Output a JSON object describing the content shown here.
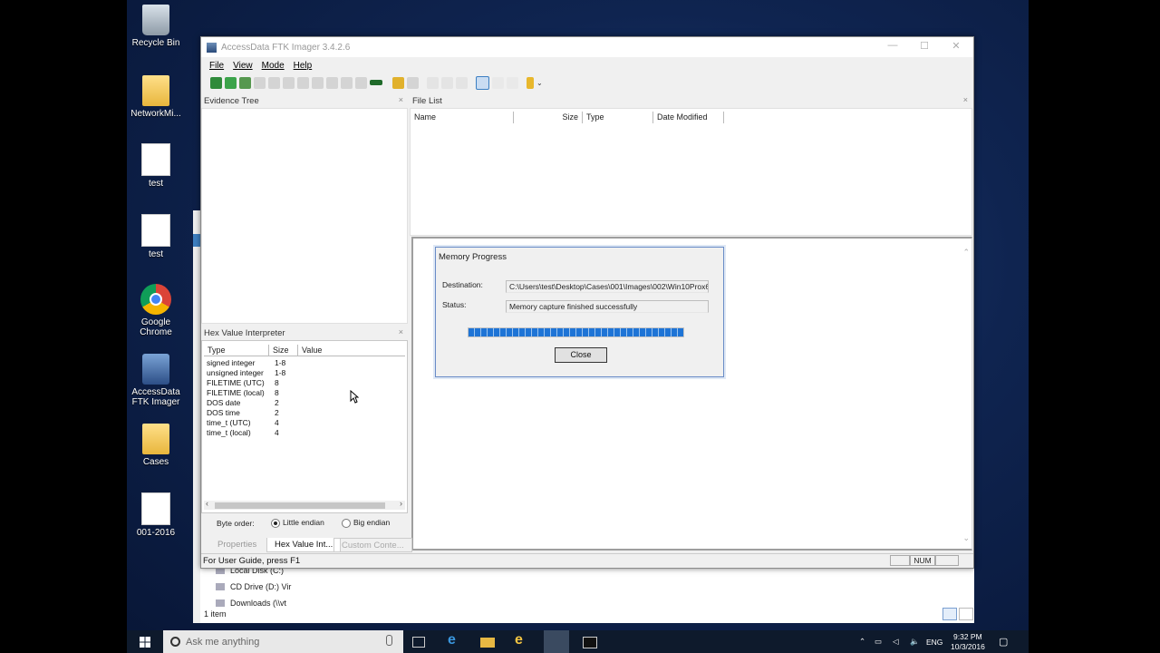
{
  "desktop": {
    "icons": [
      {
        "label": "Recycle Bin",
        "icon": "recycle-bin-icon"
      },
      {
        "label": "NetworkMi...",
        "icon": "folder-icon"
      },
      {
        "label": "test",
        "icon": "text-file-icon"
      },
      {
        "label": "test",
        "icon": "document-icon"
      },
      {
        "label": "Google Chrome",
        "icon": "chrome-icon"
      },
      {
        "label": "AccessData FTK Imager",
        "icon": "ftk-imager-icon"
      },
      {
        "label": "Cases",
        "icon": "folder-icon"
      },
      {
        "label": "001-2016",
        "icon": "document-icon"
      }
    ]
  },
  "explorer": {
    "items": [
      "Local Disk (C:)",
      "CD Drive (D:) Vir",
      "Downloads (\\\\vt"
    ],
    "status": "1 item"
  },
  "window": {
    "title": "AccessData FTK Imager 3.4.2.6",
    "controls": {
      "minimize": "—",
      "maximize": "☐",
      "close": "✕"
    },
    "menu": {
      "file": "File",
      "view": "View",
      "mode": "Mode",
      "help": "Help"
    },
    "evidence_tree": {
      "title": "Evidence Tree",
      "close": "×"
    },
    "file_list": {
      "title": "File List",
      "close": "×",
      "columns": [
        "Name",
        "Size",
        "Type",
        "Date Modified"
      ]
    },
    "hex_interpreter": {
      "title": "Hex Value Interpreter",
      "close": "×",
      "columns": [
        "Type",
        "Size",
        "Value"
      ],
      "rows": [
        {
          "type": "signed integer",
          "size": "1-8"
        },
        {
          "type": "unsigned integer",
          "size": "1-8"
        },
        {
          "type": "FILETIME (UTC)",
          "size": "8"
        },
        {
          "type": "FILETIME (local)",
          "size": "8"
        },
        {
          "type": "DOS date",
          "size": "2"
        },
        {
          "type": "DOS time",
          "size": "2"
        },
        {
          "type": "time_t (UTC)",
          "size": "4"
        },
        {
          "type": "time_t (local)",
          "size": "4"
        }
      ],
      "byte_order_label": "Byte order:",
      "little_endian": "Little endian",
      "big_endian": "Big endian",
      "selected": "Little endian"
    },
    "tabs": [
      "Properties",
      "Hex Value Int...",
      "Custom Conte..."
    ],
    "status": {
      "text": "For User Guide, press F1",
      "num": "NUM"
    }
  },
  "dialog": {
    "title": "Memory Progress",
    "destination_label": "Destination:",
    "destination_value": "C:\\Users\\test\\Desktop\\Cases\\001\\Images\\002\\Win10Prox6",
    "status_label": "Status:",
    "status_value": "Memory capture finished successfully",
    "progress": 1.0,
    "close_button": "Close"
  },
  "taskbar": {
    "search_placeholder": "Ask me anything",
    "language": "ENG",
    "time": "9:32 PM",
    "date": "10/3/2016"
  },
  "colors": {
    "accent": "#1e74d6",
    "taskbar": "#0e1a2c",
    "desktop": "#0f2450"
  }
}
